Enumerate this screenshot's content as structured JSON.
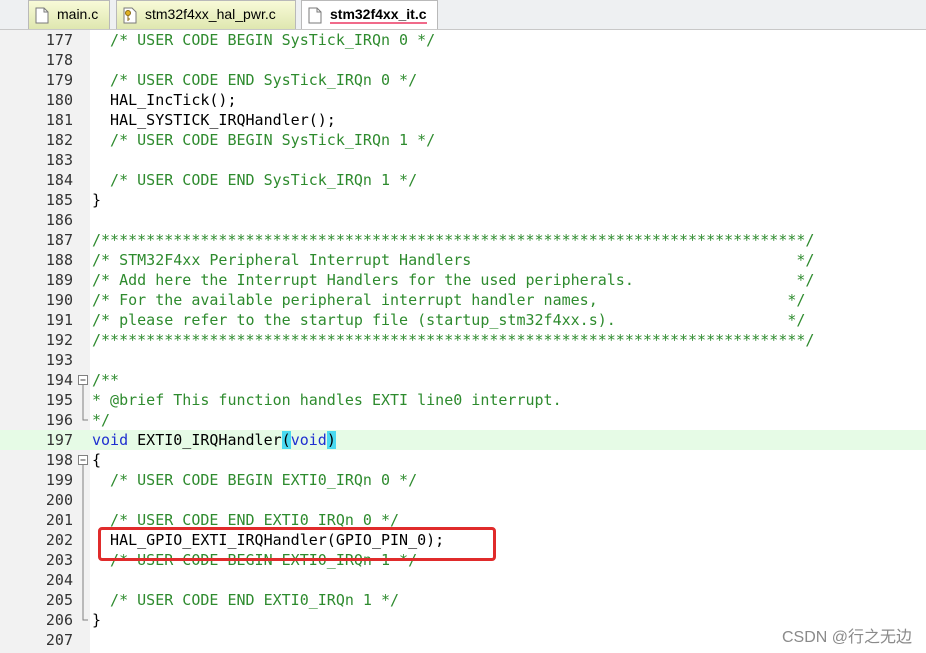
{
  "tabs": [
    {
      "label": "main.c",
      "active": false
    },
    {
      "label": "stm32f4xx_hal_pwr.c",
      "active": false
    },
    {
      "label": "stm32f4xx_it.c",
      "active": true
    }
  ],
  "colors": {
    "comment": "#2e8b2e",
    "keyword": "#1f2fd0",
    "highlight_line": "#e6fbe6",
    "brace_match": "#4ad9f0",
    "annotation_box": "#e02b2b"
  },
  "lines": [
    {
      "n": "177",
      "text": "  /* USER CODE BEGIN SysTick_IRQn 0 */"
    },
    {
      "n": "178",
      "text": ""
    },
    {
      "n": "179",
      "text": "  /* USER CODE END SysTick_IRQn 0 */"
    },
    {
      "n": "180",
      "text": "  HAL_IncTick();"
    },
    {
      "n": "181",
      "text": "  HAL_SYSTICK_IRQHandler();"
    },
    {
      "n": "182",
      "text": "  /* USER CODE BEGIN SysTick_IRQn 1 */"
    },
    {
      "n": "183",
      "text": ""
    },
    {
      "n": "184",
      "text": "  /* USER CODE END SysTick_IRQn 1 */"
    },
    {
      "n": "185",
      "text": "}"
    },
    {
      "n": "186",
      "text": ""
    },
    {
      "n": "187",
      "text": "/******************************************************************************/"
    },
    {
      "n": "188",
      "text": "/* STM32F4xx Peripheral Interrupt Handlers                                    */"
    },
    {
      "n": "189",
      "text": "/* Add here the Interrupt Handlers for the used peripherals.                  */"
    },
    {
      "n": "190",
      "text": "/* For the available peripheral interrupt handler names,                     */"
    },
    {
      "n": "191",
      "text": "/* please refer to the startup file (startup_stm32f4xx.s).                   */"
    },
    {
      "n": "192",
      "text": "/******************************************************************************/"
    },
    {
      "n": "193",
      "text": ""
    },
    {
      "n": "194",
      "text": "/**"
    },
    {
      "n": "195",
      "text": "* @brief This function handles EXTI line0 interrupt."
    },
    {
      "n": "196",
      "text": "*/"
    },
    {
      "n": "197",
      "p1": "void",
      "p2": " EXTI0_IRQHandler",
      "p3": "(",
      "p4": "void",
      "p5": ")"
    },
    {
      "n": "198",
      "text": "{"
    },
    {
      "n": "199",
      "text": "  /* USER CODE BEGIN EXTI0_IRQn 0 */"
    },
    {
      "n": "200",
      "text": ""
    },
    {
      "n": "201",
      "text": "  /* USER CODE END EXTI0_IRQn 0 */"
    },
    {
      "n": "202",
      "text": "  HAL_GPIO_EXTI_IRQHandler(GPIO_PIN_0);"
    },
    {
      "n": "203",
      "text": "  /* USER CODE BEGIN EXTI0_IRQn 1 */"
    },
    {
      "n": "204",
      "text": ""
    },
    {
      "n": "205",
      "text": "  /* USER CODE END EXTI0_IRQn 1 */"
    },
    {
      "n": "206",
      "text": "}"
    },
    {
      "n": "207",
      "text": ""
    }
  ],
  "watermark": "CSDN @行之无边"
}
